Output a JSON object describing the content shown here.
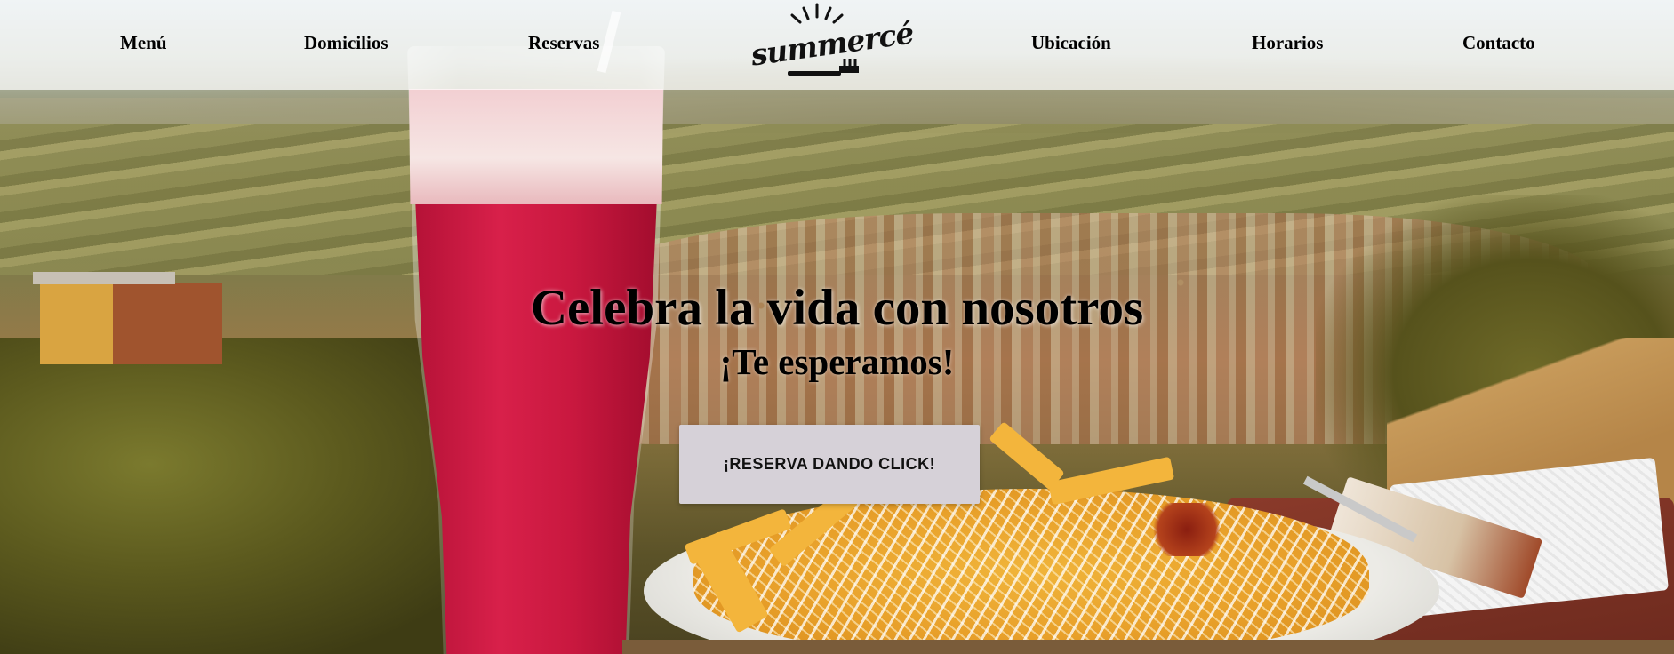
{
  "nav": {
    "items": [
      {
        "label": "Menú"
      },
      {
        "label": "Domicilios"
      },
      {
        "label": "Reservas"
      },
      {
        "label": "Ubicación"
      },
      {
        "label": "Horarios"
      },
      {
        "label": "Contacto"
      }
    ],
    "logo_text": "summercé"
  },
  "hero": {
    "title": "Celebra la vida con nosotros",
    "subtitle": "¡Te esperamos!",
    "cta_label": "¡RESERVA DANDO CLICK!"
  },
  "colors": {
    "nav_background": "#ffffff",
    "cta_background": "#d6d1d8",
    "text": "#000000"
  }
}
